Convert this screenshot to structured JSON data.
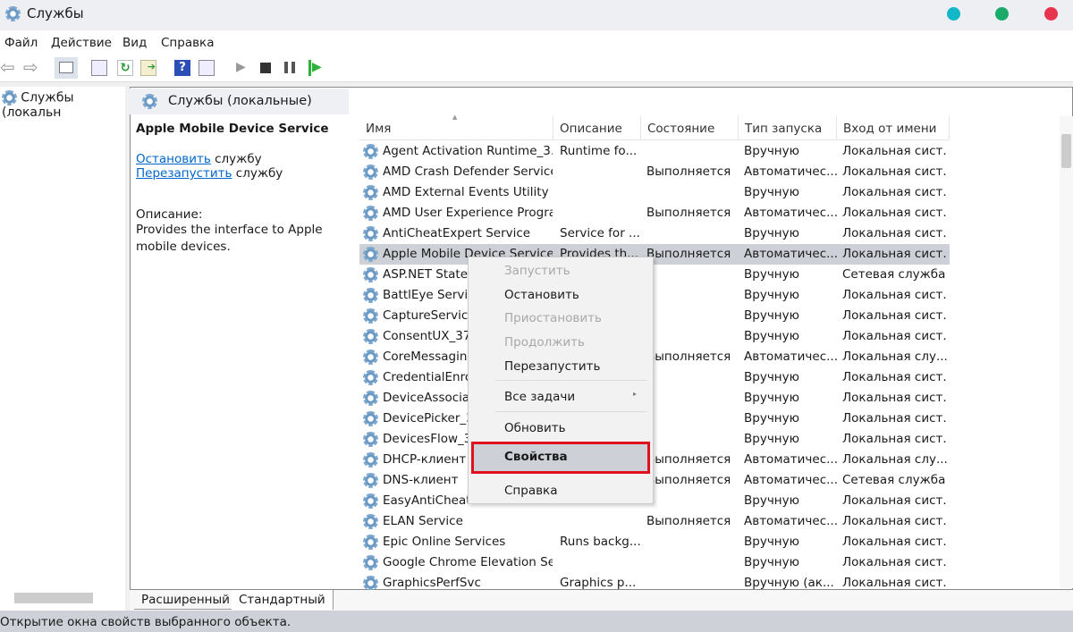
{
  "window": {
    "title": "Службы",
    "controls": {
      "colors": [
        "#13b8c8",
        "#1aab6a",
        "#e8344e"
      ]
    }
  },
  "menu": [
    "Файл",
    "Действие",
    "Вид",
    "Справка"
  ],
  "toolbar": {
    "icons": [
      "back-icon",
      "forward-icon",
      "show-hide-tree-icon",
      "properties-icon",
      "refresh-icon",
      "export-icon",
      "help-icon",
      "show-pane-icon",
      "start-icon",
      "stop-icon",
      "pause-icon",
      "resume-icon"
    ]
  },
  "tree": {
    "root": "Службы (локальн"
  },
  "panel": {
    "title": "Службы (локальные)"
  },
  "details": {
    "service_name": "Apple Mobile Device Service",
    "stop_link": "Остановить",
    "stop_suffix": " службу",
    "restart_link": "Перезапустить",
    "restart_suffix": " службу",
    "desc_label": "Описание:",
    "desc_text": "Provides the interface to Apple mobile devices."
  },
  "table": {
    "columns": [
      "Имя",
      "Описание",
      "Состояние",
      "Тип запуска",
      "Вход от имени"
    ],
    "rows": [
      [
        "Agent Activation Runtime_3...",
        "Runtime fo...",
        "",
        "Вручную",
        "Локальная сист..."
      ],
      [
        "AMD Crash Defender Service",
        "",
        "Выполняется",
        "Автоматичес...",
        "Локальная сист..."
      ],
      [
        "AMD External Events Utility",
        "",
        "",
        "Вручную",
        "Локальная сист..."
      ],
      [
        "AMD User Experience Progra...",
        "",
        "Выполняется",
        "Автоматичес...",
        "Локальная сист..."
      ],
      [
        "AntiCheatExpert Service",
        "Service for ...",
        "",
        "Вручную",
        "Локальная сист..."
      ],
      [
        "Apple Mobile Device Service",
        "Provides th...",
        "Выполняется",
        "Автоматичес...",
        "Локальная сист..."
      ],
      [
        "ASP.NET State S",
        "",
        "",
        "Вручную",
        "Сетевая служба"
      ],
      [
        "BattlEye Service",
        "",
        "",
        "Вручную",
        "Локальная сист..."
      ],
      [
        "CaptureService",
        "",
        "",
        "Вручную",
        "Локальная сист..."
      ],
      [
        "ConsentUX_378",
        "",
        "",
        "Вручную",
        "Локальная сист..."
      ],
      [
        "CoreMessaging",
        "",
        "Выполняется",
        "Автоматичес...",
        "Локальная слу..."
      ],
      [
        "CredentialEnro",
        "",
        "",
        "Вручную",
        "Локальная сист..."
      ],
      [
        "DeviceAssociati",
        "",
        "",
        "Вручную",
        "Локальная сист..."
      ],
      [
        "DevicePicker_37",
        "",
        "",
        "Вручную",
        "Локальная сист..."
      ],
      [
        "DevicesFlow_37",
        "",
        "",
        "Вручную",
        "Локальная сист..."
      ],
      [
        "DHCP-клиент",
        "",
        "Выполняется",
        "Автоматичес...",
        "Локальная слу..."
      ],
      [
        "DNS-клиент",
        "",
        "Выполняется",
        "Автоматичес...",
        "Сетевая служба"
      ],
      [
        "EasyAntiCheat",
        "",
        "",
        "Вручную",
        "Локальная сист..."
      ],
      [
        "ELAN Service",
        "",
        "Выполняется",
        "Автоматичес...",
        "Локальная сист..."
      ],
      [
        "Epic Online Services",
        "Runs backg...",
        "",
        "Вручную",
        "Локальная сист..."
      ],
      [
        "Google Chrome Elevation Se...",
        "",
        "",
        "Вручную",
        "Локальная сист..."
      ],
      [
        "GraphicsPerfSvc",
        "Graphics p...",
        "",
        "Вручную (ак...",
        "Локальная сист..."
      ]
    ],
    "selected_index": 5
  },
  "context_menu": {
    "items": [
      {
        "label": "Запустить",
        "disabled": true
      },
      {
        "label": "Остановить",
        "disabled": false
      },
      {
        "label": "Приостановить",
        "disabled": true
      },
      {
        "label": "Продолжить",
        "disabled": true
      },
      {
        "label": "Перезапустить",
        "disabled": false
      },
      {
        "label": "Все задачи",
        "disabled": false,
        "submenu": true
      },
      {
        "label": "Обновить",
        "disabled": false
      },
      {
        "label": "Свойства",
        "disabled": false,
        "highlighted": true,
        "bold": true
      },
      {
        "label": "Справка",
        "disabled": false
      }
    ],
    "highlight_color": "#e0101c"
  },
  "tabs": [
    "Расширенный",
    "Стандартный"
  ],
  "status": "Открытие окна свойств выбранного объекта."
}
